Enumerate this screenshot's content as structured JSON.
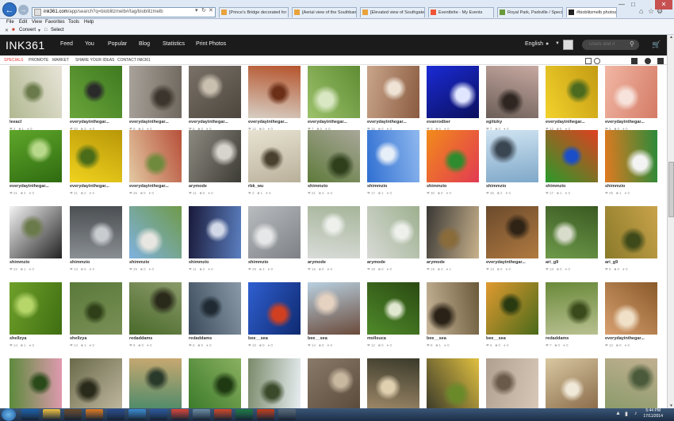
{
  "browser": {
    "address_host": "ink361.com",
    "address_path": "/app/search?q=bioblitzmelb#/tag/bioblitzmelb",
    "tabs": [
      {
        "label": "[Prince's Bridge decorated for ...",
        "color": "#e8a33d"
      },
      {
        "label": "[Aerial view of the Southbank ...",
        "color": "#e8a33d"
      },
      {
        "label": "[Elevated view of Southgate F...",
        "color": "#e8a33d"
      },
      {
        "label": "Eventbrite - My Events",
        "color": "#f05537"
      },
      {
        "label": "Royal Park, Parkville / Species ...",
        "color": "#6a9a3a"
      },
      {
        "label": "#bioblitzmelb photos - INK...",
        "color": "#222222"
      }
    ],
    "menu": [
      "File",
      "Edit",
      "View",
      "Favorites",
      "Tools",
      "Help"
    ],
    "commands": [
      "Convert",
      "Select"
    ],
    "icons": {
      "back": "arrow-left-icon",
      "forward": "arrow-right-icon",
      "home": "home-icon",
      "favorites": "star-icon",
      "settings": "gear-icon"
    }
  },
  "site": {
    "logo": "INK361",
    "nav": [
      "Feed",
      "You",
      "Popular",
      "Blog",
      "Statistics",
      "Print Photos"
    ],
    "language": "English",
    "search_placeholder": "Users and #",
    "subnav": [
      "SPECIALS",
      "PROMOTE",
      "MARKET",
      "SHARE YOUR IDEAS",
      "CONTACT INK361"
    ],
    "accent": "#e53935"
  },
  "photos": [
    {
      "user": "leeacl",
      "likes": "2",
      "comments": "1",
      "repins": "0",
      "colors": [
        "#d8d4c8",
        "#9a8f78",
        "#4a3a22"
      ]
    },
    {
      "user": "everydayinthegar...",
      "likes": "20",
      "comments": "3",
      "repins": "0",
      "colors": [
        "#6aa53a",
        "#3f7a21",
        "#2a2a2a"
      ]
    },
    {
      "user": "everydayinthegar...",
      "likes": "9",
      "comments": "2",
      "repins": "0",
      "colors": [
        "#a8a29a",
        "#6f685f",
        "#3c352d"
      ]
    },
    {
      "user": "everydayinthegar...",
      "likes": "6",
      "comments": "0",
      "repins": "0",
      "colors": [
        "#7a7268",
        "#4d463d",
        "#c9c0b0"
      ]
    },
    {
      "user": "everydayinthegar...",
      "likes": "12",
      "comments": "0",
      "repins": "0",
      "colors": [
        "#d7cfc4",
        "#b5542c",
        "#6b2f17"
      ]
    },
    {
      "user": "everydayinthegar...",
      "likes": "7",
      "comments": "0",
      "repins": "0",
      "colors": [
        "#9cc26b",
        "#5f8c34",
        "#d9e7c3"
      ]
    },
    {
      "user": "everydayinthegar...",
      "likes": "15",
      "comments": "0",
      "repins": "0",
      "colors": [
        "#c9a58a",
        "#8a5b40",
        "#efe3d6"
      ]
    },
    {
      "user": "evanrodber",
      "likes": "3",
      "comments": "0",
      "repins": "0",
      "colors": [
        "#1a2bd6",
        "#0b0f5c",
        "#e0e6ff"
      ]
    },
    {
      "user": "eglitzky",
      "likes": "7",
      "comments": "0",
      "repins": "0",
      "colors": [
        "#6b5e58",
        "#c7a9a0",
        "#2f2622"
      ]
    },
    {
      "user": "everydayinthegar...",
      "likes": "12",
      "comments": "6",
      "repins": "0",
      "colors": [
        "#f2d22c",
        "#c49b13",
        "#4d6b1e"
      ]
    },
    {
      "user": "everydayinthegar...",
      "likes": "3",
      "comments": "0",
      "repins": "0",
      "colors": [
        "#f1b7a4",
        "#d47b66",
        "#f7e3dc"
      ]
    },
    {
      "user": "everydayinthegar...",
      "likes": "21",
      "comments": "2",
      "repins": "0",
      "colors": [
        "#5fa62a",
        "#2f6b10",
        "#b8d98a"
      ]
    },
    {
      "user": "everydayinthegar...",
      "likes": "21",
      "comments": "2",
      "repins": "0",
      "colors": [
        "#f0d21e",
        "#b89708",
        "#4a6b18"
      ]
    },
    {
      "user": "everydayinthegar...",
      "likes": "26",
      "comments": "0",
      "repins": "0",
      "colors": [
        "#e3c9a2",
        "#b7503a",
        "#6f8a3c"
      ]
    },
    {
      "user": "arymode",
      "likes": "11",
      "comments": "0",
      "repins": "0",
      "colors": [
        "#8c8a80",
        "#3d3b35",
        "#d6d4cc"
      ]
    },
    {
      "user": "rbk_wu",
      "likes": "3",
      "comments": "1",
      "repins": "0",
      "colors": [
        "#e8e3d2",
        "#b9b09a",
        "#4a4030"
      ]
    },
    {
      "user": "shimmzio",
      "likes": "21",
      "comments": "3",
      "repins": "0",
      "colors": [
        "#5e7a3a",
        "#a9a79a",
        "#2f3f1c"
      ]
    },
    {
      "user": "shimmzio",
      "likes": "17",
      "comments": "1",
      "repins": "0",
      "colors": [
        "#2f6fd2",
        "#8fb8ee",
        "#e6eef8"
      ]
    },
    {
      "user": "shimmzio",
      "likes": "30",
      "comments": "0",
      "repins": "0",
      "colors": [
        "#f28b1a",
        "#e23a52",
        "#2e8b2e"
      ]
    },
    {
      "user": "shimmzio",
      "likes": "25",
      "comments": "2",
      "repins": "0",
      "colors": [
        "#cfe3f1",
        "#7fa8c9",
        "#3a4652"
      ]
    },
    {
      "user": "shimmzio",
      "likes": "17",
      "comments": "1",
      "repins": "0",
      "colors": [
        "#2a9a2a",
        "#e04020",
        "#1a4ec8"
      ]
    },
    {
      "user": "shimmzio",
      "likes": "29",
      "comments": "1",
      "repins": "0",
      "colors": [
        "#e07a20",
        "#2a8a3a",
        "#f3f3f3"
      ]
    },
    {
      "user": "shimmzio",
      "likes": "22",
      "comments": "1",
      "repins": "0",
      "colors": [
        "#f4f4f4",
        "#222222",
        "#6b7a4a"
      ]
    },
    {
      "user": "shimmzio",
      "likes": "13",
      "comments": "0",
      "repins": "0",
      "colors": [
        "#8a8f93",
        "#4b4f52",
        "#c9cccf"
      ]
    },
    {
      "user": "shimmzio",
      "likes": "29",
      "comments": "0",
      "repins": "0",
      "colors": [
        "#7fb2e0",
        "#6f9a4a",
        "#e8e6e0"
      ]
    },
    {
      "user": "shimmzio",
      "likes": "11",
      "comments": "2",
      "repins": "0",
      "colors": [
        "#1a1a3a",
        "#5b7fc0",
        "#d2d8e8"
      ]
    },
    {
      "user": "shimmzio",
      "likes": "28",
      "comments": "3",
      "repins": "0",
      "colors": [
        "#b9bcbf",
        "#7d8185",
        "#e6e7e8"
      ]
    },
    {
      "user": "arymode",
      "likes": "15",
      "comments": "0",
      "repins": "0",
      "colors": [
        "#d9dcd8",
        "#a6b59a",
        "#eef0ec"
      ]
    },
    {
      "user": "arymode",
      "likes": "19",
      "comments": "0",
      "repins": "0",
      "colors": [
        "#d8dad6",
        "#9db08f",
        "#eef0ec"
      ]
    },
    {
      "user": "arymode",
      "likes": "19",
      "comments": "4",
      "repins": "1",
      "colors": [
        "#3a3835",
        "#c9b28c",
        "#8a6b3a"
      ]
    },
    {
      "user": "everydayinthegar...",
      "likes": "13",
      "comments": "0",
      "repins": "0",
      "colors": [
        "#6b4a2c",
        "#b07a40",
        "#2f2316"
      ]
    },
    {
      "user": "ari_g9",
      "likes": "13",
      "comments": "0",
      "repins": "0",
      "colors": [
        "#6e9a4a",
        "#3a5a22",
        "#d8dccb"
      ]
    },
    {
      "user": "ari_g9",
      "likes": "9",
      "comments": "0",
      "repins": "0",
      "colors": [
        "#8a7a2a",
        "#c9a34a",
        "#3f4a1a"
      ]
    },
    {
      "user": "shellzya",
      "likes": "14",
      "comments": "1",
      "repins": "0",
      "colors": [
        "#6fa02a",
        "#3f6e12",
        "#b6d66a"
      ]
    },
    {
      "user": "shellzya",
      "likes": "14",
      "comments": "1",
      "repins": "0",
      "colors": [
        "#5a7a3a",
        "#7a8f56",
        "#2f4018"
      ]
    },
    {
      "user": "redaddams",
      "likes": "9",
      "comments": "0",
      "repins": "0",
      "colors": [
        "#4a6a2a",
        "#8a9a6a",
        "#2a2a1a"
      ]
    },
    {
      "user": "redaddams",
      "likes": "6",
      "comments": "0",
      "repins": "0",
      "colors": [
        "#3a4a5a",
        "#8a9aa8",
        "#1f2a33"
      ]
    },
    {
      "user": "bee__sea",
      "likes": "10",
      "comments": "0",
      "repins": "0",
      "colors": [
        "#2f5fd0",
        "#0f2a70",
        "#d04020"
      ]
    },
    {
      "user": "bee__sea",
      "likes": "14",
      "comments": "0",
      "repins": "0",
      "colors": [
        "#b8d0e0",
        "#6a4a3a",
        "#e6d2c0"
      ]
    },
    {
      "user": "mollsuca",
      "likes": "12",
      "comments": "0",
      "repins": "0",
      "colors": [
        "#4f8a2a",
        "#2a4a12",
        "#e0e8d0"
      ]
    },
    {
      "user": "bee__sea",
      "likes": "8",
      "comments": "1",
      "repins": "0",
      "colors": [
        "#c9b69a",
        "#6a5a3a",
        "#2a2216"
      ]
    },
    {
      "user": "bee__sea",
      "likes": "6",
      "comments": "0",
      "repins": "0",
      "colors": [
        "#e09a30",
        "#4a6a1a",
        "#2a3a10"
      ]
    },
    {
      "user": "redaddams",
      "likes": "7",
      "comments": "0",
      "repins": "0",
      "colors": [
        "#6a8a3a",
        "#b8c090",
        "#3a4a1a"
      ]
    },
    {
      "user": "everydayinthegar...",
      "likes": "12",
      "comments": "0",
      "repins": "0",
      "colors": [
        "#d8a070",
        "#8a5a2a",
        "#f0e0c8"
      ]
    },
    {
      "user": "",
      "likes": "",
      "comments": "",
      "repins": "",
      "colors": [
        "#5a8a3a",
        "#e09ab0",
        "#2a4a1a"
      ]
    },
    {
      "user": "",
      "likes": "",
      "comments": "",
      "repins": "",
      "colors": [
        "#6a6a4a",
        "#c0b8a0",
        "#2a2a1a"
      ]
    },
    {
      "user": "",
      "likes": "",
      "comments": "",
      "repins": "",
      "colors": [
        "#4a8a6a",
        "#c8a870",
        "#2a3a2a"
      ]
    },
    {
      "user": "",
      "likes": "",
      "comments": "",
      "repins": "",
      "colors": [
        "#3a7a2a",
        "#8ab060",
        "#1f3a12"
      ]
    },
    {
      "user": "",
      "likes": "",
      "comments": "",
      "repins": "",
      "colors": [
        "#7a8a6a",
        "#e8eef2",
        "#3a4a2a"
      ]
    },
    {
      "user": "",
      "likes": "",
      "comments": "",
      "repins": "",
      "colors": [
        "#8a7a6a",
        "#5a4a3a",
        "#c8b8a0"
      ]
    },
    {
      "user": "",
      "likes": "",
      "comments": "",
      "repins": "",
      "colors": [
        "#a08a6a",
        "#3a3a2a",
        "#e0d0b0"
      ]
    },
    {
      "user": "",
      "likes": "",
      "comments": "",
      "repins": "",
      "colors": [
        "#3a3a2a",
        "#e0c040",
        "#6a8a2a"
      ]
    },
    {
      "user": "",
      "likes": "",
      "comments": "",
      "repins": "",
      "colors": [
        "#b0a090",
        "#d8c8b8",
        "#6a5a4a"
      ]
    },
    {
      "user": "",
      "likes": "",
      "comments": "",
      "repins": "",
      "colors": [
        "#d8c8a0",
        "#8a6a4a",
        "#f0e8d8"
      ]
    },
    {
      "user": "",
      "likes": "",
      "comments": "",
      "repins": "",
      "colors": [
        "#8a9a6a",
        "#c0b090",
        "#4a5a3a"
      ]
    },
    {
      "user": "",
      "likes": "",
      "comments": "",
      "repins": "",
      "colors": [
        "#b0b890",
        "#e8e4d8",
        "#6a7a4a"
      ]
    }
  ],
  "taskbar": {
    "apps": [
      "#1b5fa8",
      "#f0c040",
      "#6a4a2a",
      "#e07a20",
      "#2a4a8a",
      "#3a8ad0",
      "#2b579a",
      "#db4437",
      "#6a8aa0",
      "#d24726",
      "#1d7a45",
      "#c43e1c",
      "#5a6a7a"
    ],
    "time": "5:44 PM",
    "date": "17/11/2014"
  }
}
